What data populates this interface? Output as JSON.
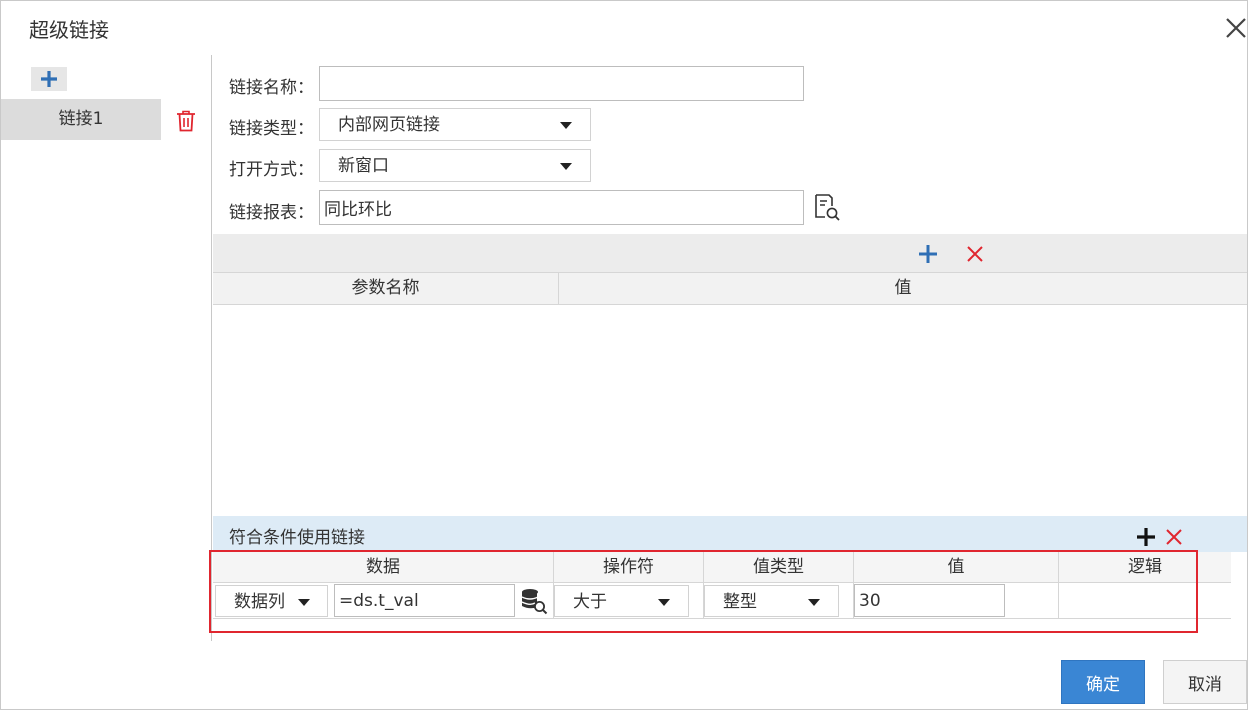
{
  "dialog": {
    "title": "超级链接"
  },
  "sidebar": {
    "items": [
      {
        "label": "链接1"
      }
    ]
  },
  "form": {
    "link_name": {
      "label": "链接名称：",
      "value": ""
    },
    "link_type": {
      "label": "链接类型：",
      "value": "内部网页链接"
    },
    "open_mode": {
      "label": "打开方式：",
      "value": "新窗口"
    },
    "link_report": {
      "label": "链接报表：",
      "value": "同比环比"
    }
  },
  "params": {
    "columns": [
      "参数名称",
      "值"
    ]
  },
  "conditions": {
    "title": "符合条件使用链接",
    "columns": [
      "数据",
      "操作符",
      "值类型",
      "值",
      "逻辑"
    ],
    "rows": [
      {
        "data_type": "数据列",
        "expression": "=ds.t_val",
        "operator": "大于",
        "value_type": "整型",
        "value": "30",
        "logic": ""
      }
    ]
  },
  "footer": {
    "ok_label": "确定",
    "cancel_label": "取消"
  },
  "colors": {
    "accent": "#3a86d4",
    "danger": "#e0262f",
    "add_icon": "#2f6fb5",
    "condition_header_bg": "#ddebf6"
  }
}
